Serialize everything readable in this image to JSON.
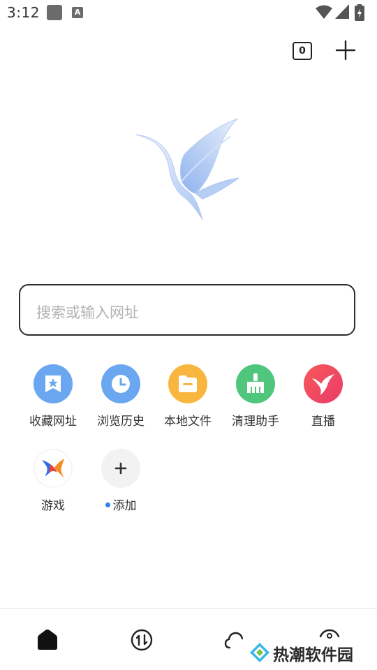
{
  "status_bar": {
    "time": "3:12",
    "notification_letter": "A"
  },
  "toolbar": {
    "tab_count": "0"
  },
  "search": {
    "placeholder": "搜索或输入网址"
  },
  "shortcuts": [
    {
      "label": "收藏网址",
      "icon": "bookmark-star-icon",
      "color": "#6aa7f0"
    },
    {
      "label": "浏览历史",
      "icon": "clock-icon",
      "color": "#6aa7f0"
    },
    {
      "label": "本地文件",
      "icon": "folder-icon",
      "color": "#f8b63f"
    },
    {
      "label": "清理助手",
      "icon": "broom-icon",
      "color": "#4fc67c"
    },
    {
      "label": "直播",
      "icon": "bird-icon",
      "color": "#ef4c5a"
    },
    {
      "label": "游戏",
      "icon": "game-x-icon",
      "color": "#ffffff"
    },
    {
      "label": "添加",
      "icon": "plus-icon",
      "color": "#f2f2f2"
    }
  ],
  "bottom_nav": {
    "items": [
      "home-icon",
      "transfer-icon",
      "cloud-icon",
      "profile-icon"
    ]
  },
  "watermark": {
    "text": "热潮软件园"
  }
}
